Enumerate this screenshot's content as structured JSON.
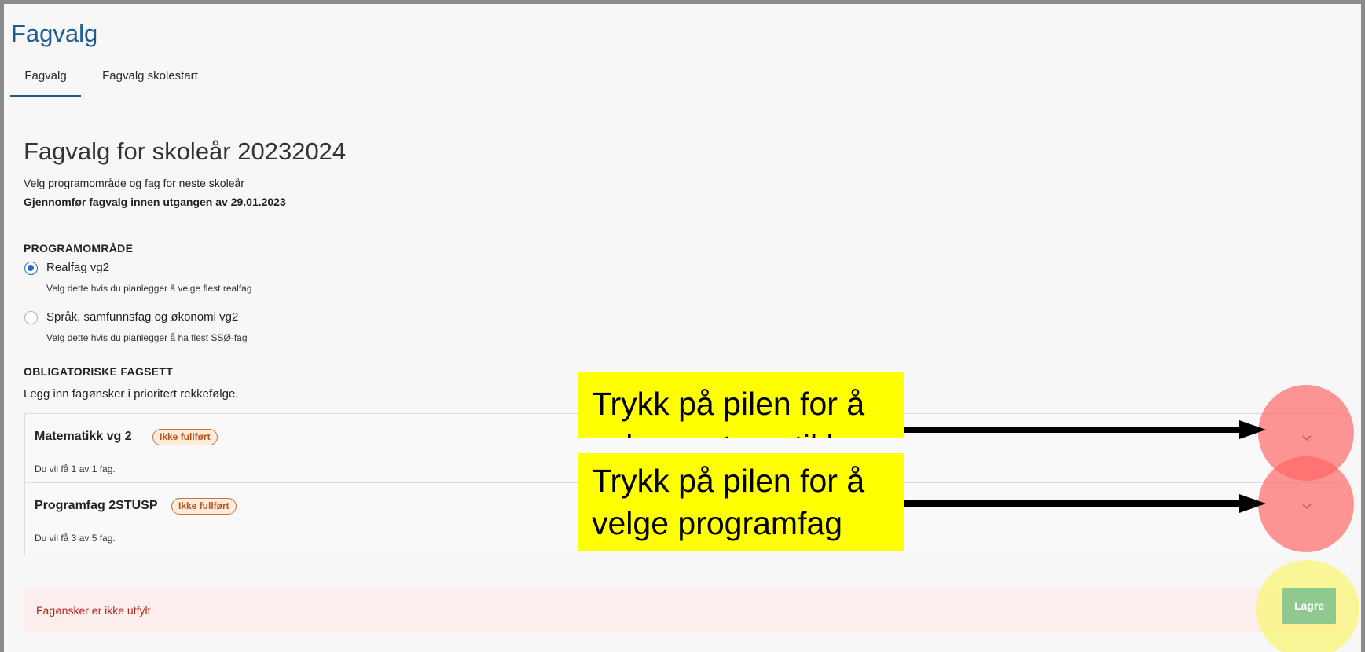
{
  "app": {
    "title": "Fagvalg"
  },
  "tabs": [
    {
      "label": "Fagvalg",
      "active": true
    },
    {
      "label": "Fagvalg skolestart",
      "active": false
    }
  ],
  "page": {
    "title": "Fagvalg for skoleår 20232024",
    "subtitle": "Velg programområde og fag for neste skoleår",
    "deadline": "Gjennomfør fagvalg innen utgangen av 29.01.2023"
  },
  "program": {
    "label": "PROGRAMOMRÅDE",
    "options": [
      {
        "label": "Realfag vg2",
        "desc": "Velg dette hvis du planlegger å velge flest realfag",
        "checked": true
      },
      {
        "label": "Språk, samfunnsfag og økonomi vg2",
        "desc": "Velg dette hvis du planlegger å ha flest SSØ-fag",
        "checked": false
      }
    ]
  },
  "obligatory": {
    "label": "OBLIGATORISKE FAGSETT",
    "instruction": "Legg inn fagønsker i prioritert rekkefølge.",
    "sets": [
      {
        "title": "Matematikk vg 2",
        "status": "Ikke fullført",
        "desc": "Du vil få 1 av 1 fag."
      },
      {
        "title": "Programfag 2STUSP",
        "status": "Ikke fullført",
        "desc": "Du vil få 3 av 5 fag."
      }
    ]
  },
  "footer": {
    "error": "Fagønsker er ikke utfylt",
    "save_label": "Lagre"
  },
  "annotations": {
    "callout_1": [
      "Trykk på pilen for å",
      "velge matematikk"
    ],
    "callout_2": [
      "Trykk på pilen for å",
      "velge programfag"
    ]
  },
  "colors": {
    "accent": "#1d5c8f",
    "radio": "#1d6fc2",
    "badge_text": "#b5541a",
    "error_text": "#b3261e",
    "save_button": "#8fc98f",
    "callout": "#ffff00"
  }
}
